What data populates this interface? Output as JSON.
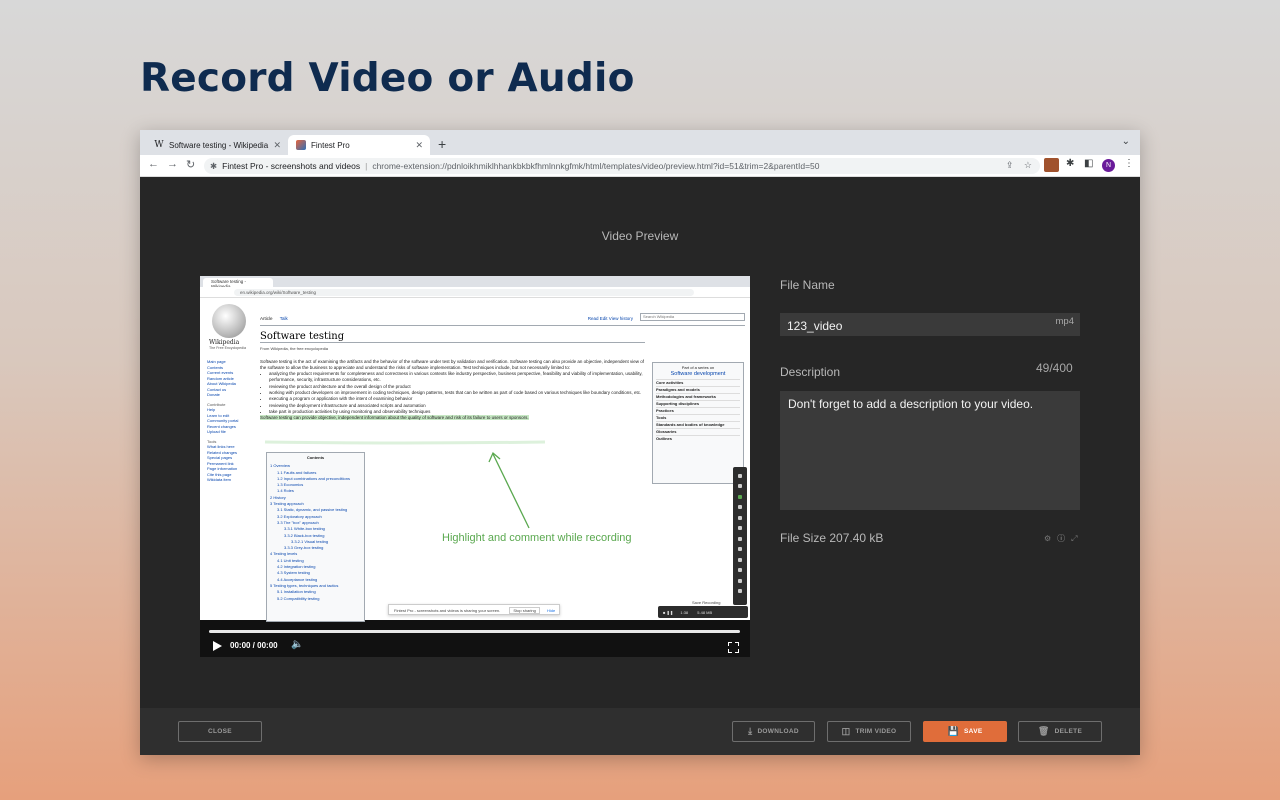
{
  "headline": "Record Video or Audio",
  "browser": {
    "tabs": [
      {
        "label": "Software testing - Wikipedia",
        "favicon": "W"
      },
      {
        "label": "Fintest Pro",
        "favicon": "fintest-logo"
      }
    ],
    "address": {
      "site": "Fintest Pro - screenshots and videos",
      "url": "chrome-extension://pdnloikhmiklhhankbkbkfhmlnnkgfmk/html/templates/video/preview.html?id=51&trim=2&parentId=50"
    },
    "profile_initial": "N"
  },
  "preview": {
    "title": "Video Preview",
    "video": {
      "time": "00:00 / 00:00",
      "progress": 0,
      "frame": {
        "tab_label": "Software testing - Wikipedia",
        "url": "en.wikipedia.org/wiki/Software_testing",
        "logo_name": "Wikipedia",
        "logo_sub": "The Free Encyclopedia",
        "article_tab": "Article",
        "talk_tab": "Talk",
        "right_tabs": "Read   Edit   View history",
        "search_placeholder": "Search Wikipedia",
        "page_title": "Software testing",
        "from": "From Wikipedia, the free encyclopedia",
        "intro": "Software testing is the act of examining the artifacts and the behavior of the software under test by validation and verification. Software testing can also provide an objective, independent view of the software to allow the business to appreciate and understand the risks of software implementation. Test techniques include, but not necessarily limited to:",
        "bullets": [
          "analyzing the product requirements for completeness and correctness in various contexts like industry perspective, business perspective, feasibility and viability of implementation, usability, performance, security, infrastructure considerations, etc.",
          "reviewing the product architecture and the overall design of the product",
          "working with product developers on improvement in coding techniques, design patterns, tests that can be written as part of code based on various techniques like boundary conditions, etc.",
          "executing a program or application with the intent of examining behavior",
          "reviewing the deployment infrastructure and associated scripts and automation",
          "take part in production activities by using monitoring and observability techniques"
        ],
        "highlighted": "Software testing can provide objective, independent information about the quality of software and risk of its failure to users or sponsors.",
        "sidebar_links": [
          "Main page",
          "Contents",
          "Current events",
          "Random article",
          "About Wikipedia",
          "Contact us",
          "Donate"
        ],
        "sidebar_contribute_title": "Contribute",
        "sidebar_contribute": [
          "Help",
          "Learn to edit",
          "Community portal",
          "Recent changes",
          "Upload file"
        ],
        "sidebar_tools_title": "Tools",
        "sidebar_tools": [
          "What links here",
          "Related changes",
          "Special pages",
          "Permanent link",
          "Page information",
          "Cite this page",
          "Wikidata item"
        ],
        "infobox_title_small": "Part of a series on",
        "infobox_title": "Software development",
        "infobox_rows": [
          "Core activities",
          "Paradigms and models",
          "Methodologies and frameworks",
          "Supporting disciplines",
          "Practices",
          "Tools",
          "Standards and bodies of knowledge",
          "Glossaries",
          "Outlines"
        ],
        "toc_title": "Contents",
        "toc": [
          "1 Overview",
          "1.1 Faults and failures",
          "1.2 Input combinations and preconditions",
          "1.3 Economics",
          "1.4 Roles",
          "2 History",
          "3 Testing approach",
          "3.1 Static, dynamic, and passive testing",
          "3.2 Exploratory approach",
          "3.3 The \"box\" approach",
          "3.3.1 White-box testing",
          "3.3.2 Black-box testing",
          "3.3.2.1 Visual testing",
          "3.3.3 Grey-box testing",
          "4 Testing levels",
          "4.1 Unit testing",
          "4.2 Integration testing",
          "4.3 System testing",
          "4.4 Acceptance testing",
          "5 Testing types, techniques and tactics",
          "5.1 Installation testing",
          "5.2 Compatibility testing"
        ],
        "annotation": "Highlight and comment while recording",
        "share_text": "Fintest Pro - screenshots and videos is sharing your screen.",
        "share_stop": "Stop sharing",
        "share_hide": "Hide",
        "save_recording": "Save Recording",
        "rec_time": "1:38",
        "rec_size": "5.48 MB"
      }
    }
  },
  "panel": {
    "file_name_label": "File Name",
    "file_name_value": "123_video",
    "file_ext": "mp4",
    "description_label": "Description",
    "description_counter": "49/400",
    "description_value": "Don't forget to add a description to your video.",
    "file_size": "File Size 207.40 kB"
  },
  "footer": {
    "close": "CLOSE",
    "download": "DOWNLOAD",
    "trim": "TRIM VIDEO",
    "save": "SAVE",
    "delete": "DELETE"
  },
  "colors": {
    "headline": "#0f2b4f",
    "save_button": "#e06d3a",
    "annotation": "#5aa84f"
  }
}
